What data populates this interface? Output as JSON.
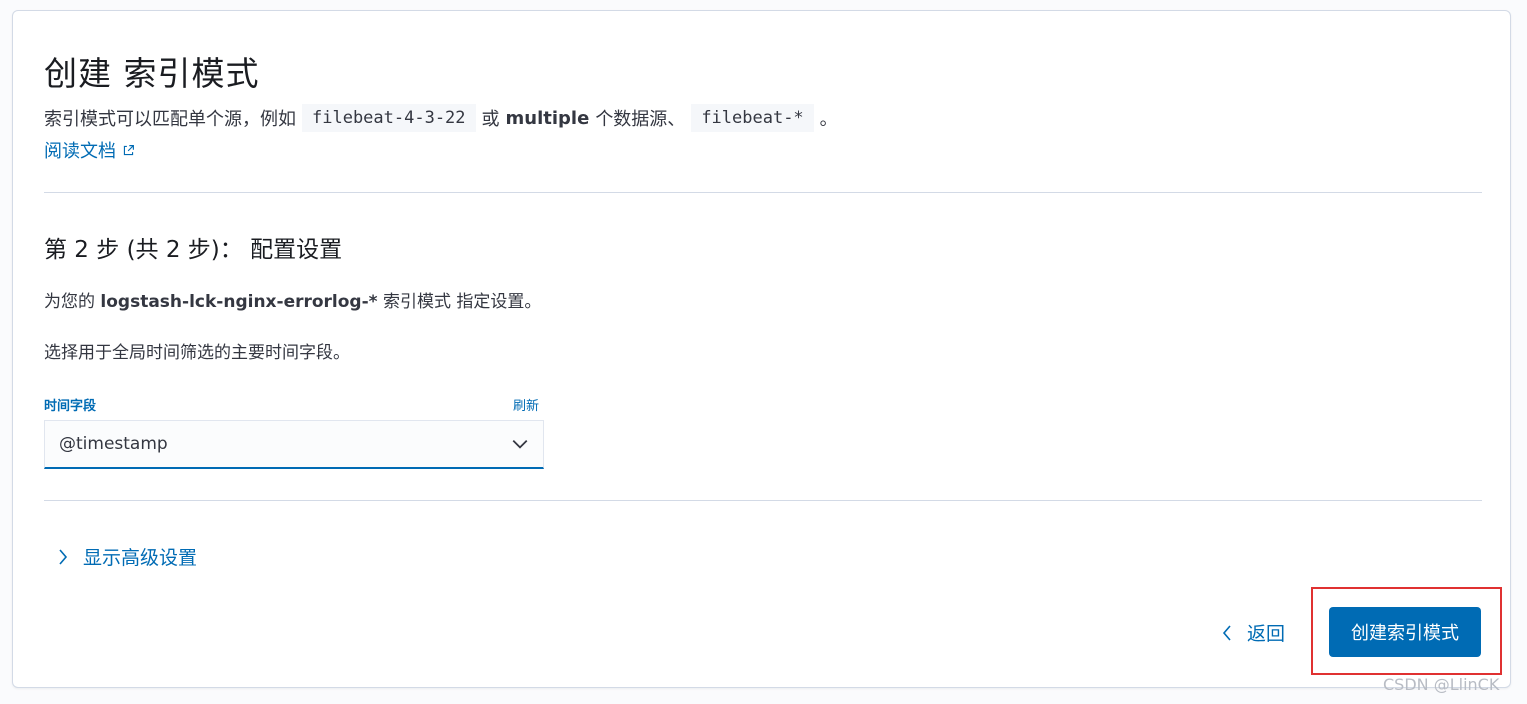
{
  "page": {
    "title": "创建 索引模式",
    "description": {
      "prefix": "索引模式可以匹配单个源，例如",
      "example_single": "filebeat-4-3-22",
      "connector": "或",
      "multiple": "multiple",
      "middle": "个数据源、",
      "example_multi": "filebeat-*",
      "suffix": "。"
    },
    "doc_link": "阅读文档"
  },
  "step": {
    "title": "第 2 步 (共 2 步)： 配置设置",
    "line1_prefix": "为您的",
    "pattern": "logstash-lck-nginx-errorlog-*",
    "line1_suffix": "索引模式 指定设置。",
    "line2": "选择用于全局时间筛选的主要时间字段。"
  },
  "time_field": {
    "label": "时间字段",
    "refresh": "刷新",
    "selected": "@timestamp"
  },
  "advanced": {
    "label": "显示高级设置"
  },
  "footer": {
    "back": "返回",
    "create": "创建索引模式"
  },
  "watermark": "CSDN @LlinCK",
  "colors": {
    "accent": "#006bb4",
    "highlight_border": "#e03131"
  }
}
